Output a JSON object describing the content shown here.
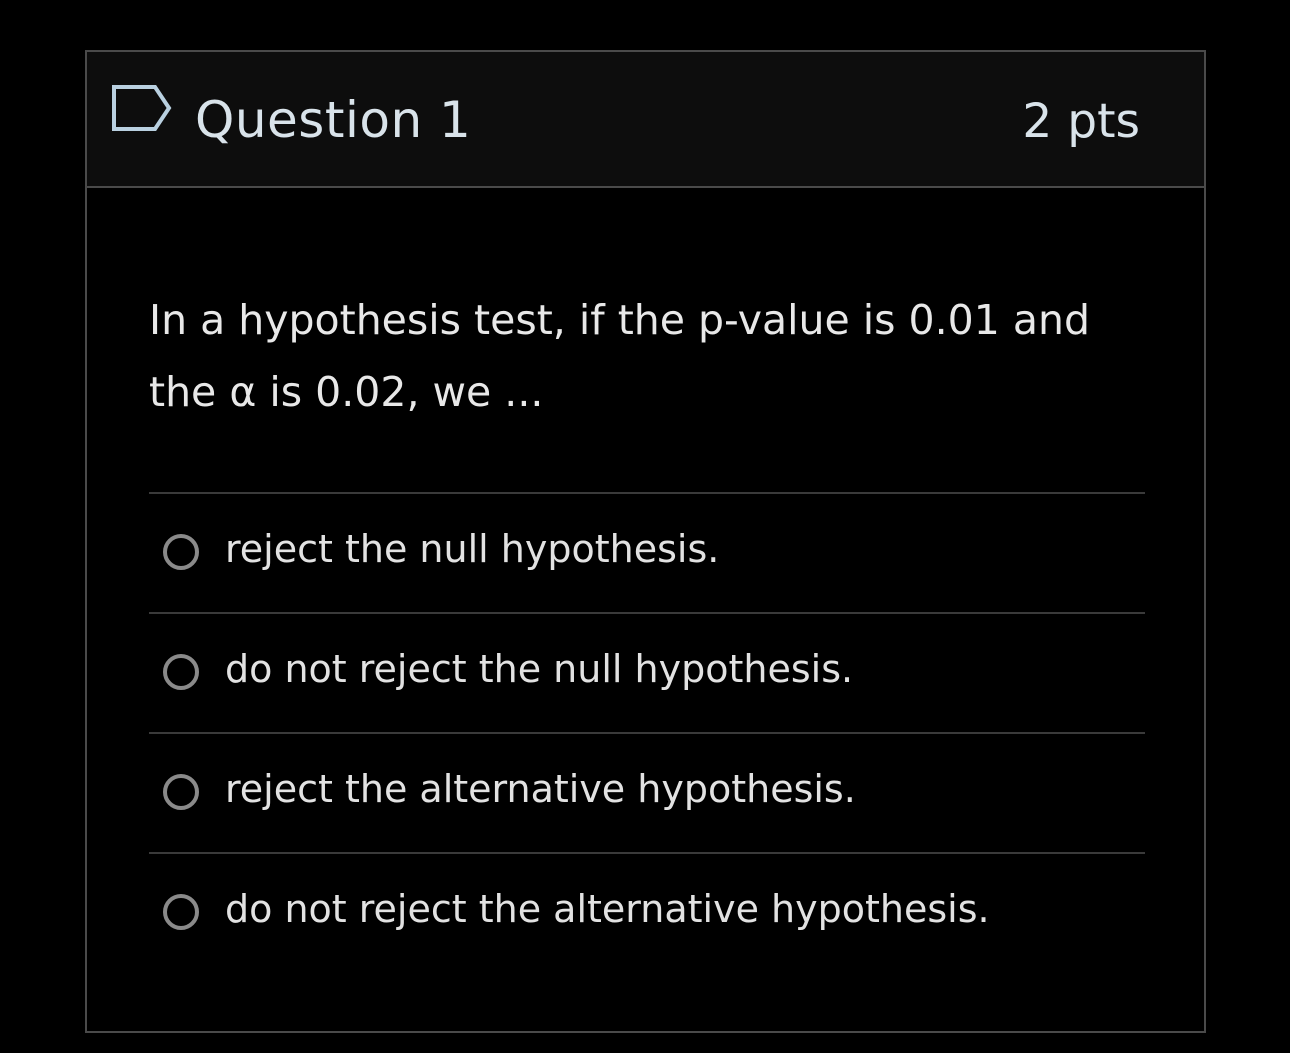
{
  "question": {
    "title": "Question 1",
    "points": "2 pts",
    "text": "In a hypothesis test, if the p-value is 0.01 and the α is 0.02, we ...",
    "flag_icon": "flag-icon",
    "answers": [
      {
        "label": "reject the null hypothesis."
      },
      {
        "label": "do not reject the null hypothesis."
      },
      {
        "label": "reject the alternative hypothesis."
      },
      {
        "label": "do not reject the alternative hypothesis."
      }
    ]
  },
  "colors": {
    "background": "#000000",
    "header_background": "#0d0d0d",
    "border": "#4a4a4a",
    "title_text": "#d9e3ea",
    "flag_outline": "#b9d0e0"
  }
}
